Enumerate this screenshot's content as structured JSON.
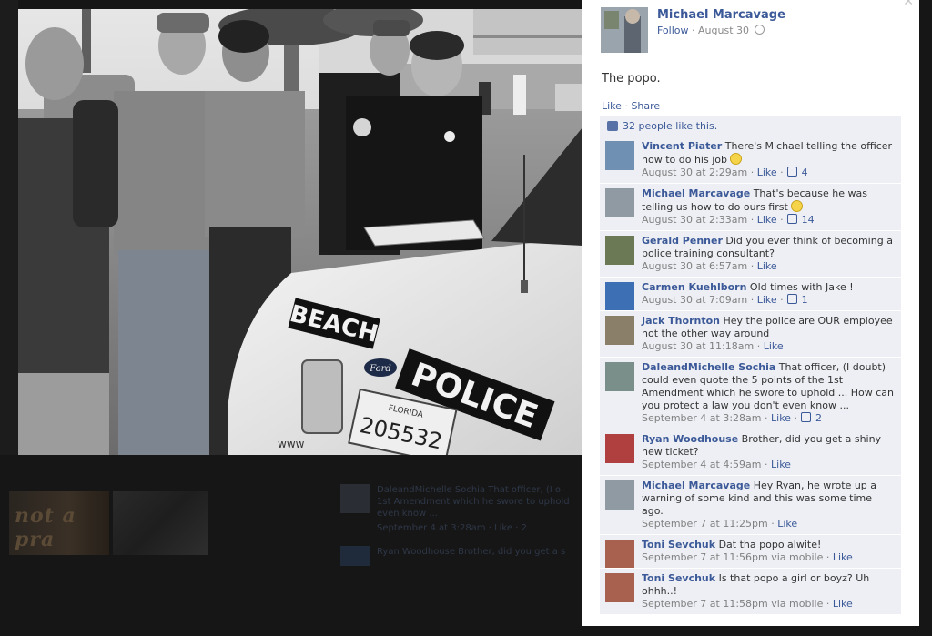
{
  "background": {
    "thumb_text": "not a pra",
    "comments": [
      {
        "line1": "DaleandMichelle Sochia That officer, (I o",
        "line2": "1st Amendment which he swore to uphold",
        "line3": "even know ...",
        "meta": "September 4 at 3:28am · Like · 2"
      },
      {
        "line1": "Ryan Woodhouse Brother, did you get a s"
      }
    ]
  },
  "photo": {
    "car_text_left": "BEACH",
    "car_text_right": "POLICE",
    "car_badge": "Ford",
    "plate_state": "FLORIDA",
    "plate_number": "205532",
    "bumper_text": "www"
  },
  "post": {
    "owner": "Michael Marcavage",
    "follow": "Follow",
    "date": "August 30",
    "caption": "The popo.",
    "like": "Like",
    "share": "Share",
    "likes_summary": "32 people like this."
  },
  "comments": [
    {
      "name": "Vincent Piater",
      "text": "There's Michael telling the officer how to do his job",
      "smiley": true,
      "time": "August 30 at 2:29am",
      "like": "Like",
      "likes": "4",
      "avatar": "#6f8fb3"
    },
    {
      "name": "Michael Marcavage",
      "text": "That's because he was telling us how to do ours first",
      "smiley": true,
      "time": "August 30 at 2:33am",
      "like": "Like",
      "likes": "14",
      "avatar": "#8f9aa3"
    },
    {
      "name": "Gerald Penner",
      "text": "Did you ever think of becoming a police training consultant?",
      "time": "August 30 at 6:57am",
      "like": "Like",
      "avatar": "#6b7a55"
    },
    {
      "name": "Carmen Kuehlborn",
      "text": "Old times with Jake !",
      "time": "August 30 at 7:09am",
      "like": "Like",
      "likes": "1",
      "avatar": "#3d6fb5"
    },
    {
      "name": "Jack Thornton",
      "text": "Hey the police are OUR employee not the other way around",
      "time": "August 30 at 11:18am",
      "like": "Like",
      "avatar": "#8a7f68"
    },
    {
      "name": "DaleandMichelle Sochia",
      "text": "That officer, (I doubt) could even quote the 5 points of the 1st Amendment which he swore to uphold ... How can you protect a law you don't even know ...",
      "time": "September 4 at 3:28am",
      "like": "Like",
      "likes": "2",
      "avatar": "#7a8f8a"
    },
    {
      "name": "Ryan Woodhouse",
      "text": "Brother, did you get a shiny new ticket?",
      "time": "September 4 at 4:59am",
      "like": "Like",
      "avatar": "#b04040"
    },
    {
      "name": "Michael Marcavage",
      "text": "Hey Ryan, he wrote up a warning of some kind and this was some time ago.",
      "time": "September 7 at 11:25pm",
      "like": "Like",
      "avatar": "#8f9aa3"
    },
    {
      "name": "Toni Sevchuk",
      "text": "Dat tha popo alwite!",
      "time": "September 7 at 11:56pm via mobile",
      "like": "Like",
      "avatar": "#a8604f"
    },
    {
      "name": "Toni Sevchuk",
      "text": "Is that popo a girl or boyz? Uh ohhh..!",
      "time": "September 7 at 11:58pm via mobile",
      "like": "Like",
      "avatar": "#a8604f"
    }
  ]
}
